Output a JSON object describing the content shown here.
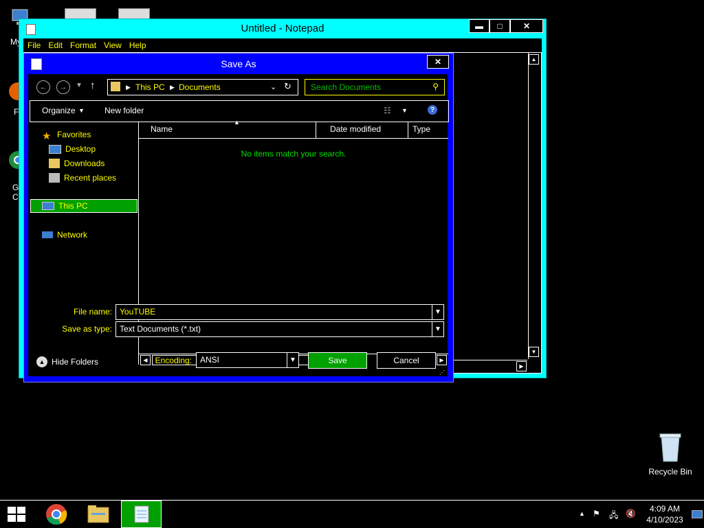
{
  "desktop": {
    "icons": [
      {
        "label": "My C"
      },
      {
        "label": "F"
      },
      {
        "label": "G"
      },
      {
        "label": "C"
      }
    ],
    "recycle_bin": "Recycle Bin"
  },
  "notepad": {
    "title": "Untitled - Notepad",
    "controls": {
      "minimize": "▬",
      "maximize": "□",
      "close": "✕"
    },
    "menu": [
      "File",
      "Edit",
      "Format",
      "View",
      "Help"
    ]
  },
  "save_dialog": {
    "title": "Save As",
    "close": "✕",
    "address": {
      "segments": [
        "This PC",
        "Documents"
      ]
    },
    "search_placeholder": "Search Documents",
    "toolbar": {
      "organize": "Organize",
      "new_folder": "New folder"
    },
    "nav": {
      "favorites": "Favorites",
      "desktop": "Desktop",
      "downloads": "Downloads",
      "recent_places": "Recent places",
      "this_pc": "This PC",
      "network": "Network"
    },
    "columns": {
      "name": "Name",
      "date_modified": "Date modified",
      "type": "Type"
    },
    "empty_message": "No items match your search.",
    "file_name_label": "File name:",
    "file_name_value": "YouTUBE",
    "save_as_type_label": "Save as type:",
    "save_as_type_value": "Text Documents (*.txt)",
    "hide_folders": "Hide Folders",
    "encoding_label": "Encoding:",
    "encoding_value": "ANSI",
    "save_button": "Save",
    "cancel_button": "Cancel"
  },
  "taskbar": {
    "time": "4:09 AM",
    "date": "4/10/2023"
  },
  "colors": {
    "notepad_frame": "#00ffff",
    "dialog_frame": "#0000ff",
    "accent_text": "#ffff00",
    "selection": "#00a000",
    "empty_text": "#00e000"
  }
}
